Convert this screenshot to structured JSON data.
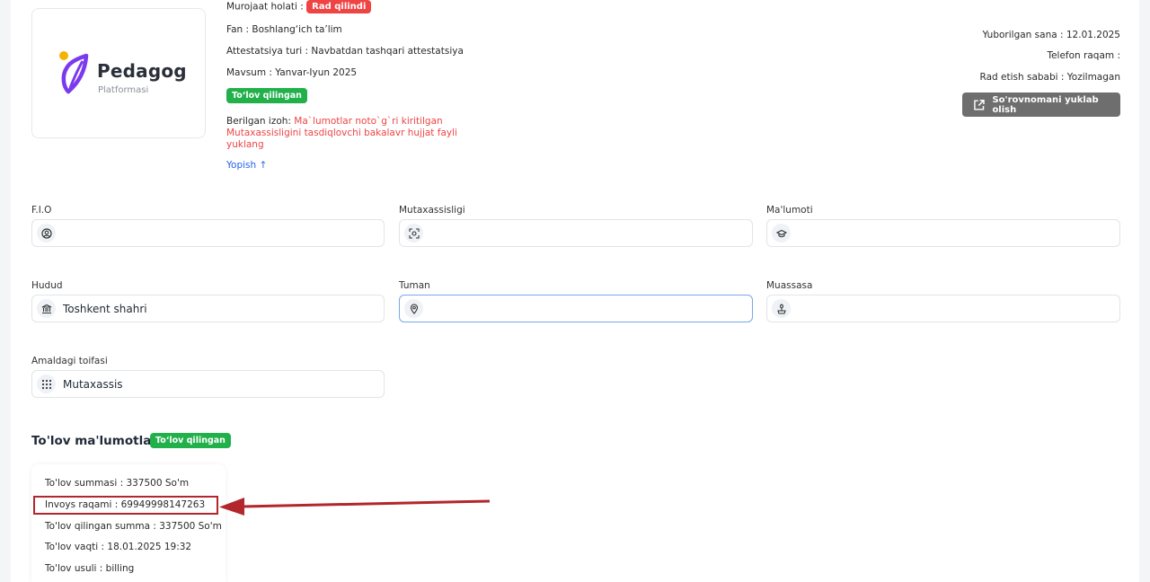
{
  "logo": {
    "title": "Pedagog",
    "subtitle": "Platformasi"
  },
  "info": {
    "status_label": "Murojaat holati :",
    "status_badge": "Rad qilindi",
    "fan": "Fan : Boshlang‘ich ta’lim",
    "attestatsiya": "Attestatsiya turi : Navbatdan tashqari attestatsiya",
    "mavsum": "Mavsum : Yanvar-Iyun 2025",
    "payment_badge": "To‘lov qilingan",
    "comment_label": "Berilgan izoh:",
    "comment_line1": "Ma`lumotlar noto`g`ri kiritilgan",
    "comment_line2": "Mutaxassisligini tasdiqlovchi bakalavr hujjat fayli",
    "comment_line3": "yuklang",
    "close_link": "Yopish ↑"
  },
  "right": {
    "date": "Yuborilgan sana : 12.01.2025",
    "phone": "Telefon raqam :",
    "reject_reason": "Rad etish sababi : Yozilmagan",
    "download_button": "So'rovnomani yuklab olish"
  },
  "form": {
    "fio_label": "F.I.O",
    "fio_value": "",
    "mutaxassisligi_label": "Mutaxassisligi",
    "mutaxassisligi_value": "",
    "malumoti_label": "Ma'lumoti",
    "malumoti_value": "",
    "hudud_label": "Hudud",
    "hudud_value": "Toshkent shahri",
    "tuman_label": "Tuman",
    "tuman_value": "",
    "muassasa_label": "Muassasa",
    "muassasa_value": "",
    "toifa_label": "Amaldagi toifasi",
    "toifa_value": "Mutaxassis"
  },
  "payment": {
    "title": "To'lov ma'lumotlari :",
    "badge": "To‘lov qilingan",
    "summa": "To'lov summasi : 337500 So'm",
    "invoice": "Invoys raqami : 69949998147263",
    "paid_summa": "To'lov qilingan summa : 337500 So'm",
    "time": "To'lov vaqti : 18.01.2025 19:32",
    "method": "To'lov usuli : billing"
  },
  "colors": {
    "danger": "#ef4444",
    "success": "#22b04b",
    "accent": "#2563eb",
    "logo_purple": "#7c3aed",
    "logo_yellow": "#f5b301"
  }
}
